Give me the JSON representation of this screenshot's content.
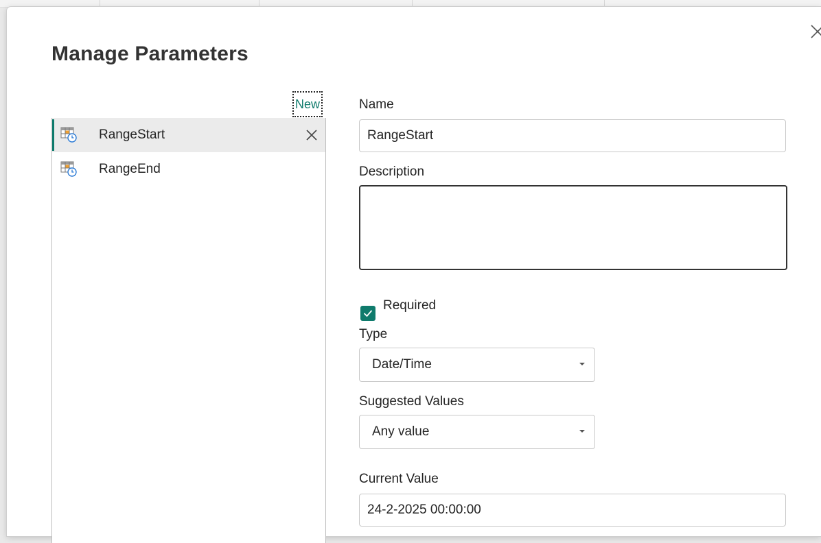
{
  "dialog": {
    "title": "Manage Parameters",
    "new_link": "New"
  },
  "parameters": [
    {
      "label": "RangeStart",
      "selected": true
    },
    {
      "label": "RangeEnd",
      "selected": false
    }
  ],
  "form": {
    "name_label": "Name",
    "name_value": "RangeStart",
    "description_label": "Description",
    "description_value": "",
    "required_label": "Required",
    "required_checked": true,
    "type_label": "Type",
    "type_value": "Date/Time",
    "suggested_label": "Suggested Values",
    "suggested_value": "Any value",
    "current_label": "Current Value",
    "current_value": "24-2-2025 00:00:00"
  },
  "colors": {
    "accent": "#0f7b6c",
    "text": "#242424"
  },
  "icons": {
    "close": "close-icon",
    "parameter": "table-clock-icon",
    "delete": "delete-x-icon",
    "dropdown": "chevron-down-icon",
    "check": "checkmark-icon"
  }
}
